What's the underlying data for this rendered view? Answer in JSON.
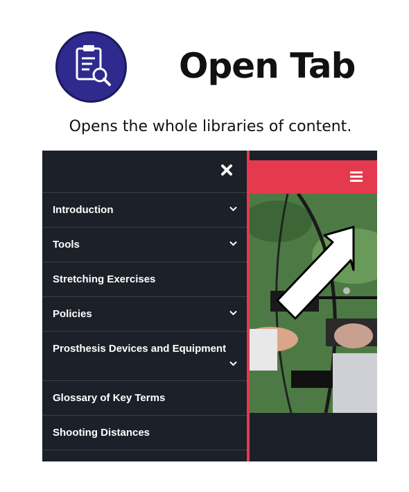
{
  "header": {
    "title": "Open Tab",
    "subtitle": "Opens the whole libraries of content.",
    "logo_icon": "clipboard-search-icon"
  },
  "colors": {
    "logo_bg": "#2e2a8e",
    "menu_bg": "#1c2028",
    "accent": "#e53a4e"
  },
  "menu": {
    "close_icon": "close-icon",
    "items": [
      {
        "label": "Introduction",
        "has_submenu": true
      },
      {
        "label": "Tools",
        "has_submenu": true
      },
      {
        "label": "Stretching Exercises",
        "has_submenu": false
      },
      {
        "label": "Policies",
        "has_submenu": true
      },
      {
        "label": "Prosthesis Devices and Equipment",
        "has_submenu": true
      },
      {
        "label": "Glossary of Key Terms",
        "has_submenu": false
      },
      {
        "label": "Shooting Distances",
        "has_submenu": false
      }
    ]
  },
  "topbar": {
    "hamburger_icon": "hamburger-menu-icon",
    "pointer_icon": "arrow-pointer-icon"
  },
  "image": {
    "subject": "archer drawing a compound bow"
  }
}
